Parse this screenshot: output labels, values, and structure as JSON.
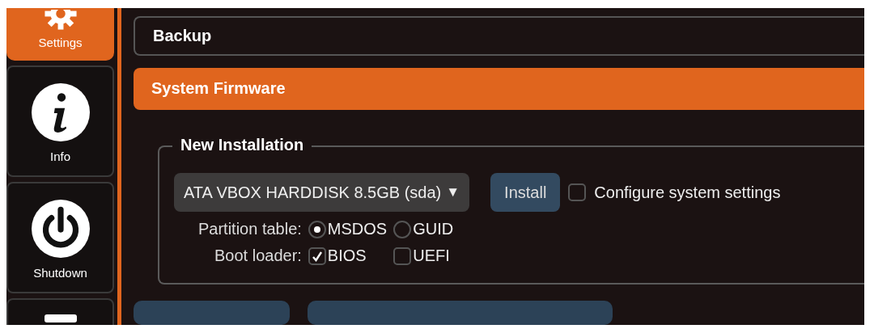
{
  "sidebar": {
    "items": [
      {
        "label": "Settings",
        "kind": "gear",
        "selected": true
      },
      {
        "label": "Info",
        "kind": "info",
        "selected": false
      },
      {
        "label": "Shutdown",
        "kind": "power",
        "selected": false
      },
      {
        "kind": "blank",
        "selected": false
      }
    ]
  },
  "sections": [
    {
      "title": "Backup",
      "selected": false
    },
    {
      "title": "System Firmware",
      "selected": true
    }
  ],
  "new_installation": {
    "title": "New Installation",
    "disk": {
      "value": "ATA VBOX HARDDISK 8.5GB (sda)",
      "caret": "▼"
    },
    "install_button": "Install",
    "configure": {
      "label": "Configure system settings",
      "checked": false
    },
    "partition_table": {
      "label": "Partition table:",
      "options": [
        {
          "label": "MSDOS",
          "selected": true
        },
        {
          "label": "GUID",
          "selected": false
        }
      ]
    },
    "boot_loader": {
      "label": "Boot loader:",
      "options": [
        {
          "label": "BIOS",
          "checked": true
        },
        {
          "label": "UEFI",
          "checked": false
        }
      ]
    }
  }
}
